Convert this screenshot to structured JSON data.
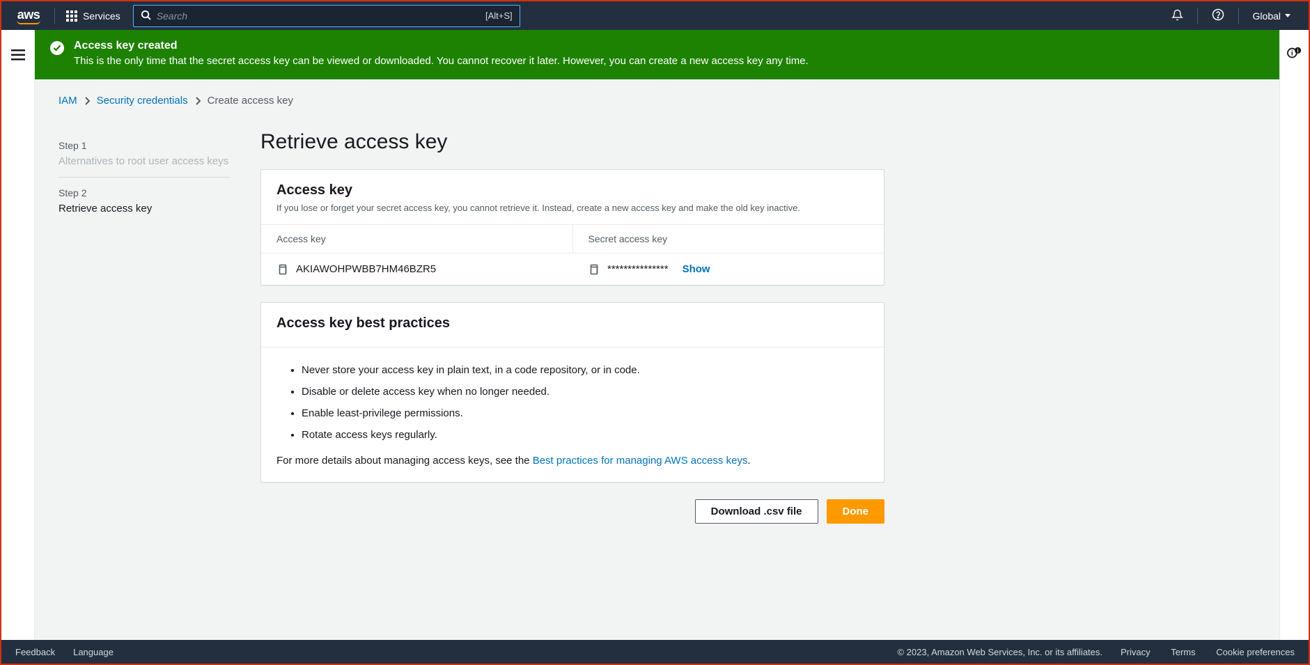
{
  "topnav": {
    "logo_text": "aws",
    "services_label": "Services",
    "search_placeholder": "Search",
    "search_shortcut": "[Alt+S]",
    "region_label": "Global"
  },
  "banner": {
    "title": "Access key created",
    "message": "This is the only time that the secret access key can be viewed or downloaded. You cannot recover it later. However, you can create a new access key any time."
  },
  "breadcrumb": {
    "items": [
      {
        "label": "IAM",
        "link": true
      },
      {
        "label": "Security credentials",
        "link": true
      },
      {
        "label": "Create access key",
        "link": false
      }
    ]
  },
  "steps": [
    {
      "num": "Step 1",
      "label": "Alternatives to root user access keys",
      "active": false
    },
    {
      "num": "Step 2",
      "label": "Retrieve access key",
      "active": true
    }
  ],
  "page_title": "Retrieve access key",
  "access_key_panel": {
    "title": "Access key",
    "description": "If you lose or forget your secret access key, you cannot retrieve it. Instead, create a new access key and make the old key inactive.",
    "col1_header": "Access key",
    "col2_header": "Secret access key",
    "access_key_value": "AKIAWOHPWBB7HM46BZR5",
    "secret_masked": "***************",
    "show_label": "Show"
  },
  "best_practices_panel": {
    "title": "Access key best practices",
    "items": [
      "Never store your access key in plain text, in a code repository, or in code.",
      "Disable or delete access key when no longer needed.",
      "Enable least-privilege permissions.",
      "Rotate access keys regularly."
    ],
    "more_prefix": "For more details about managing access keys, see the ",
    "more_link": "Best practices for managing AWS access keys",
    "more_suffix": "."
  },
  "actions": {
    "download_label": "Download .csv file",
    "done_label": "Done"
  },
  "footer": {
    "feedback": "Feedback",
    "language": "Language",
    "copyright": "© 2023, Amazon Web Services, Inc. or its affiliates.",
    "privacy": "Privacy",
    "terms": "Terms",
    "cookies": "Cookie preferences"
  }
}
